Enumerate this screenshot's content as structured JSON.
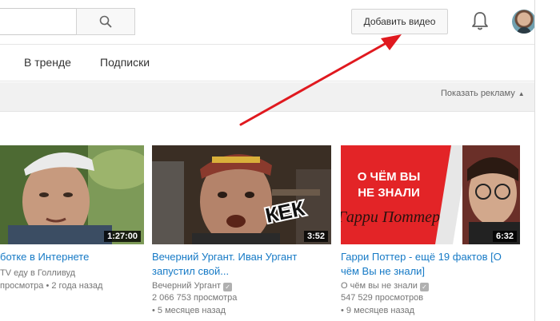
{
  "header": {
    "add_video_label": "Добавить видео"
  },
  "tabs": [
    {
      "label": "В тренде"
    },
    {
      "label": "Подписки"
    }
  ],
  "ads": {
    "label": "Показать рекламу"
  },
  "videos": [
    {
      "title": "ботке в Интернете",
      "channel": "TV еду в Голливуд",
      "stats": "просмотра • 2 года назад",
      "duration": "1:27:00"
    },
    {
      "title": "Вечерний Ургант. Иван Ургант запустил свой...",
      "channel": "Вечерний Ургант",
      "views": "2 066 753 просмотра",
      "date": "• 5 месяцев назад",
      "duration": "3:52",
      "overlay_text": "КЕК"
    },
    {
      "title": "Гарри Поттер - ещё 19 фактов [О чём Вы не знали]",
      "channel": "О чём вы не знали",
      "views": "547 529 просмотров",
      "date": "• 9 месяцев назад",
      "duration": "6:32",
      "overlay_text": "О ЧЁМ ВЫ НЕ ЗНАЛИ",
      "logo_text": "Гарри Поттер"
    }
  ],
  "colors": {
    "link": "#167ac6",
    "arrow": "#e0191f",
    "accent_red": "#e32427"
  }
}
